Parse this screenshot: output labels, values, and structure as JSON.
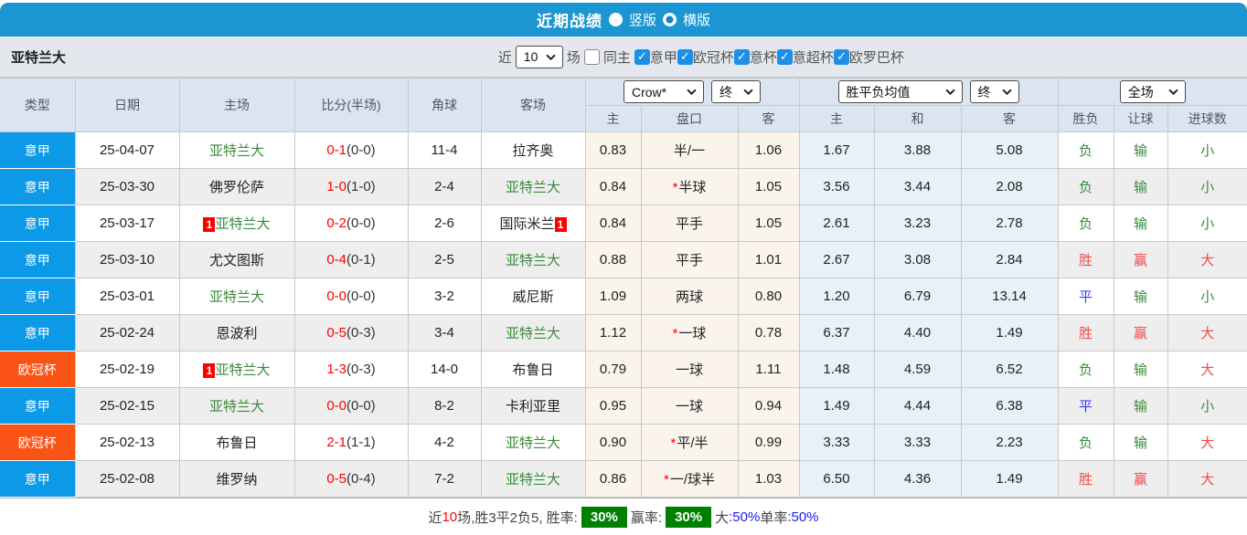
{
  "colors": {
    "topbar_blue": "#1b96d2",
    "league_serie_a_blue": "#0c99e8",
    "league_ucl_orange": "#fa5316",
    "handicap_cols_bg": "#fbf4ec",
    "odds_cols_bg": "#e7f1f7",
    "win_red": "#f5494c",
    "draw_blue": "#3b3bff",
    "lose_green": "#3a8a3a",
    "score_red": "#ff0000",
    "badge_green": "#008000"
  },
  "titlebar": {
    "title": "近期战绩",
    "radio_vertical_label": "竖版",
    "radio_horizontal_label": "横版",
    "selected": "横版"
  },
  "filterbar": {
    "team": "亚特兰大",
    "near_label": "近",
    "near_value": "10",
    "games_label": "场",
    "same_home_label": "同主",
    "same_home_checked": false,
    "leagues": [
      {
        "label": "意甲",
        "checked": true
      },
      {
        "label": "欧冠杯",
        "checked": true
      },
      {
        "label": "意杯",
        "checked": true
      },
      {
        "label": "意超杯",
        "checked": true
      },
      {
        "label": "欧罗巴杯",
        "checked": true
      }
    ]
  },
  "table": {
    "dropdowns": {
      "company": "Crow*",
      "company_time": "终",
      "europe": "胜平负均值",
      "europe_time": "终",
      "period": "全场"
    },
    "headers": {
      "type": "类型",
      "date": "日期",
      "home": "主场",
      "score": "比分(半场)",
      "corner": "角球",
      "away": "客场",
      "ah_home": "主",
      "ah_line": "盘口",
      "ah_away": "客",
      "eu_home": "主",
      "eu_draw": "和",
      "eu_away": "客",
      "result": "胜负",
      "handicap_result": "让球",
      "goals": "进球数"
    },
    "rows": [
      {
        "league": "意甲",
        "league_color": "blue",
        "date": "25-04-07",
        "home": "亚特兰大",
        "home_green": true,
        "home_card": false,
        "score_ft": "0-1",
        "score_ht": "(0-0)",
        "corner": "11-4",
        "away": "拉齐奥",
        "away_green": false,
        "away_card": false,
        "ah_home": "0.83",
        "ah_star": false,
        "ah_line": "半/一",
        "ah_away": "1.06",
        "eu_home": "1.67",
        "eu_draw": "3.88",
        "eu_away": "5.08",
        "outcome": "负",
        "handicap": "输",
        "goals": "小"
      },
      {
        "league": "意甲",
        "league_color": "blue",
        "date": "25-03-30",
        "home": "佛罗伦萨",
        "home_green": false,
        "home_card": false,
        "score_ft": "1-0",
        "score_ht": "(1-0)",
        "corner": "2-4",
        "away": "亚特兰大",
        "away_green": true,
        "away_card": false,
        "ah_home": "0.84",
        "ah_star": true,
        "ah_line": "半球",
        "ah_away": "1.05",
        "eu_home": "3.56",
        "eu_draw": "3.44",
        "eu_away": "2.08",
        "outcome": "负",
        "handicap": "输",
        "goals": "小"
      },
      {
        "league": "意甲",
        "league_color": "blue",
        "date": "25-03-17",
        "home": "亚特兰大",
        "home_green": true,
        "home_card": true,
        "score_ft": "0-2",
        "score_ht": "(0-0)",
        "corner": "2-6",
        "away": "国际米兰",
        "away_green": false,
        "away_card": true,
        "ah_home": "0.84",
        "ah_star": false,
        "ah_line": "平手",
        "ah_away": "1.05",
        "eu_home": "2.61",
        "eu_draw": "3.23",
        "eu_away": "2.78",
        "outcome": "负",
        "handicap": "输",
        "goals": "小"
      },
      {
        "league": "意甲",
        "league_color": "blue",
        "date": "25-03-10",
        "home": "尤文图斯",
        "home_green": false,
        "home_card": false,
        "score_ft": "0-4",
        "score_ht": "(0-1)",
        "corner": "2-5",
        "away": "亚特兰大",
        "away_green": true,
        "away_card": false,
        "ah_home": "0.88",
        "ah_star": false,
        "ah_line": "平手",
        "ah_away": "1.01",
        "eu_home": "2.67",
        "eu_draw": "3.08",
        "eu_away": "2.84",
        "outcome": "胜",
        "handicap": "赢",
        "goals": "大"
      },
      {
        "league": "意甲",
        "league_color": "blue",
        "date": "25-03-01",
        "home": "亚特兰大",
        "home_green": true,
        "home_card": false,
        "score_ft": "0-0",
        "score_ht": "(0-0)",
        "corner": "3-2",
        "away": "威尼斯",
        "away_green": false,
        "away_card": false,
        "ah_home": "1.09",
        "ah_star": false,
        "ah_line": "两球",
        "ah_away": "0.80",
        "eu_home": "1.20",
        "eu_draw": "6.79",
        "eu_away": "13.14",
        "outcome": "平",
        "handicap": "输",
        "goals": "小"
      },
      {
        "league": "意甲",
        "league_color": "blue",
        "date": "25-02-24",
        "home": "恩波利",
        "home_green": false,
        "home_card": false,
        "score_ft": "0-5",
        "score_ht": "(0-3)",
        "corner": "3-4",
        "away": "亚特兰大",
        "away_green": true,
        "away_card": false,
        "ah_home": "1.12",
        "ah_star": true,
        "ah_line": "一球",
        "ah_away": "0.78",
        "eu_home": "6.37",
        "eu_draw": "4.40",
        "eu_away": "1.49",
        "outcome": "胜",
        "handicap": "赢",
        "goals": "大"
      },
      {
        "league": "欧冠杯",
        "league_color": "orange",
        "date": "25-02-19",
        "home": "亚特兰大",
        "home_green": true,
        "home_card": true,
        "score_ft": "1-3",
        "score_ht": "(0-3)",
        "corner": "14-0",
        "away": "布鲁日",
        "away_green": false,
        "away_card": false,
        "ah_home": "0.79",
        "ah_star": false,
        "ah_line": "一球",
        "ah_away": "1.11",
        "eu_home": "1.48",
        "eu_draw": "4.59",
        "eu_away": "6.52",
        "outcome": "负",
        "handicap": "输",
        "goals": "大"
      },
      {
        "league": "意甲",
        "league_color": "blue",
        "date": "25-02-15",
        "home": "亚特兰大",
        "home_green": true,
        "home_card": false,
        "score_ft": "0-0",
        "score_ht": "(0-0)",
        "corner": "8-2",
        "away": "卡利亚里",
        "away_green": false,
        "away_card": false,
        "ah_home": "0.95",
        "ah_star": false,
        "ah_line": "一球",
        "ah_away": "0.94",
        "eu_home": "1.49",
        "eu_draw": "4.44",
        "eu_away": "6.38",
        "outcome": "平",
        "handicap": "输",
        "goals": "小"
      },
      {
        "league": "欧冠杯",
        "league_color": "orange",
        "date": "25-02-13",
        "home": "布鲁日",
        "home_green": false,
        "home_card": false,
        "score_ft": "2-1",
        "score_ht": "(1-1)",
        "corner": "4-2",
        "away": "亚特兰大",
        "away_green": true,
        "away_card": false,
        "ah_home": "0.90",
        "ah_star": true,
        "ah_line": "平/半",
        "ah_away": "0.99",
        "eu_home": "3.33",
        "eu_draw": "3.33",
        "eu_away": "2.23",
        "outcome": "负",
        "handicap": "输",
        "goals": "大"
      },
      {
        "league": "意甲",
        "league_color": "blue",
        "date": "25-02-08",
        "home": "维罗纳",
        "home_green": false,
        "home_card": false,
        "score_ft": "0-5",
        "score_ht": "(0-4)",
        "corner": "7-2",
        "away": "亚特兰大",
        "away_green": true,
        "away_card": false,
        "ah_home": "0.86",
        "ah_star": true,
        "ah_line": "一/球半",
        "ah_away": "1.03",
        "eu_home": "6.50",
        "eu_draw": "4.36",
        "eu_away": "1.49",
        "outcome": "胜",
        "handicap": "赢",
        "goals": "大"
      }
    ]
  },
  "footer": {
    "segments": [
      {
        "text": "近",
        "style": "dim"
      },
      {
        "text": "10",
        "style": "red"
      },
      {
        "text": "场,胜3平2负5, 胜率:",
        "style": "dim"
      },
      {
        "text": "30%",
        "style": "badge"
      },
      {
        "text": " 赢率:",
        "style": "dim"
      },
      {
        "text": "30%",
        "style": "badge"
      },
      {
        "text": " 大",
        "style": "dim"
      },
      {
        "text": ":50%",
        "style": "blue"
      },
      {
        "text": " 单率",
        "style": "dim"
      },
      {
        "text": ":50%",
        "style": "blue"
      }
    ]
  }
}
